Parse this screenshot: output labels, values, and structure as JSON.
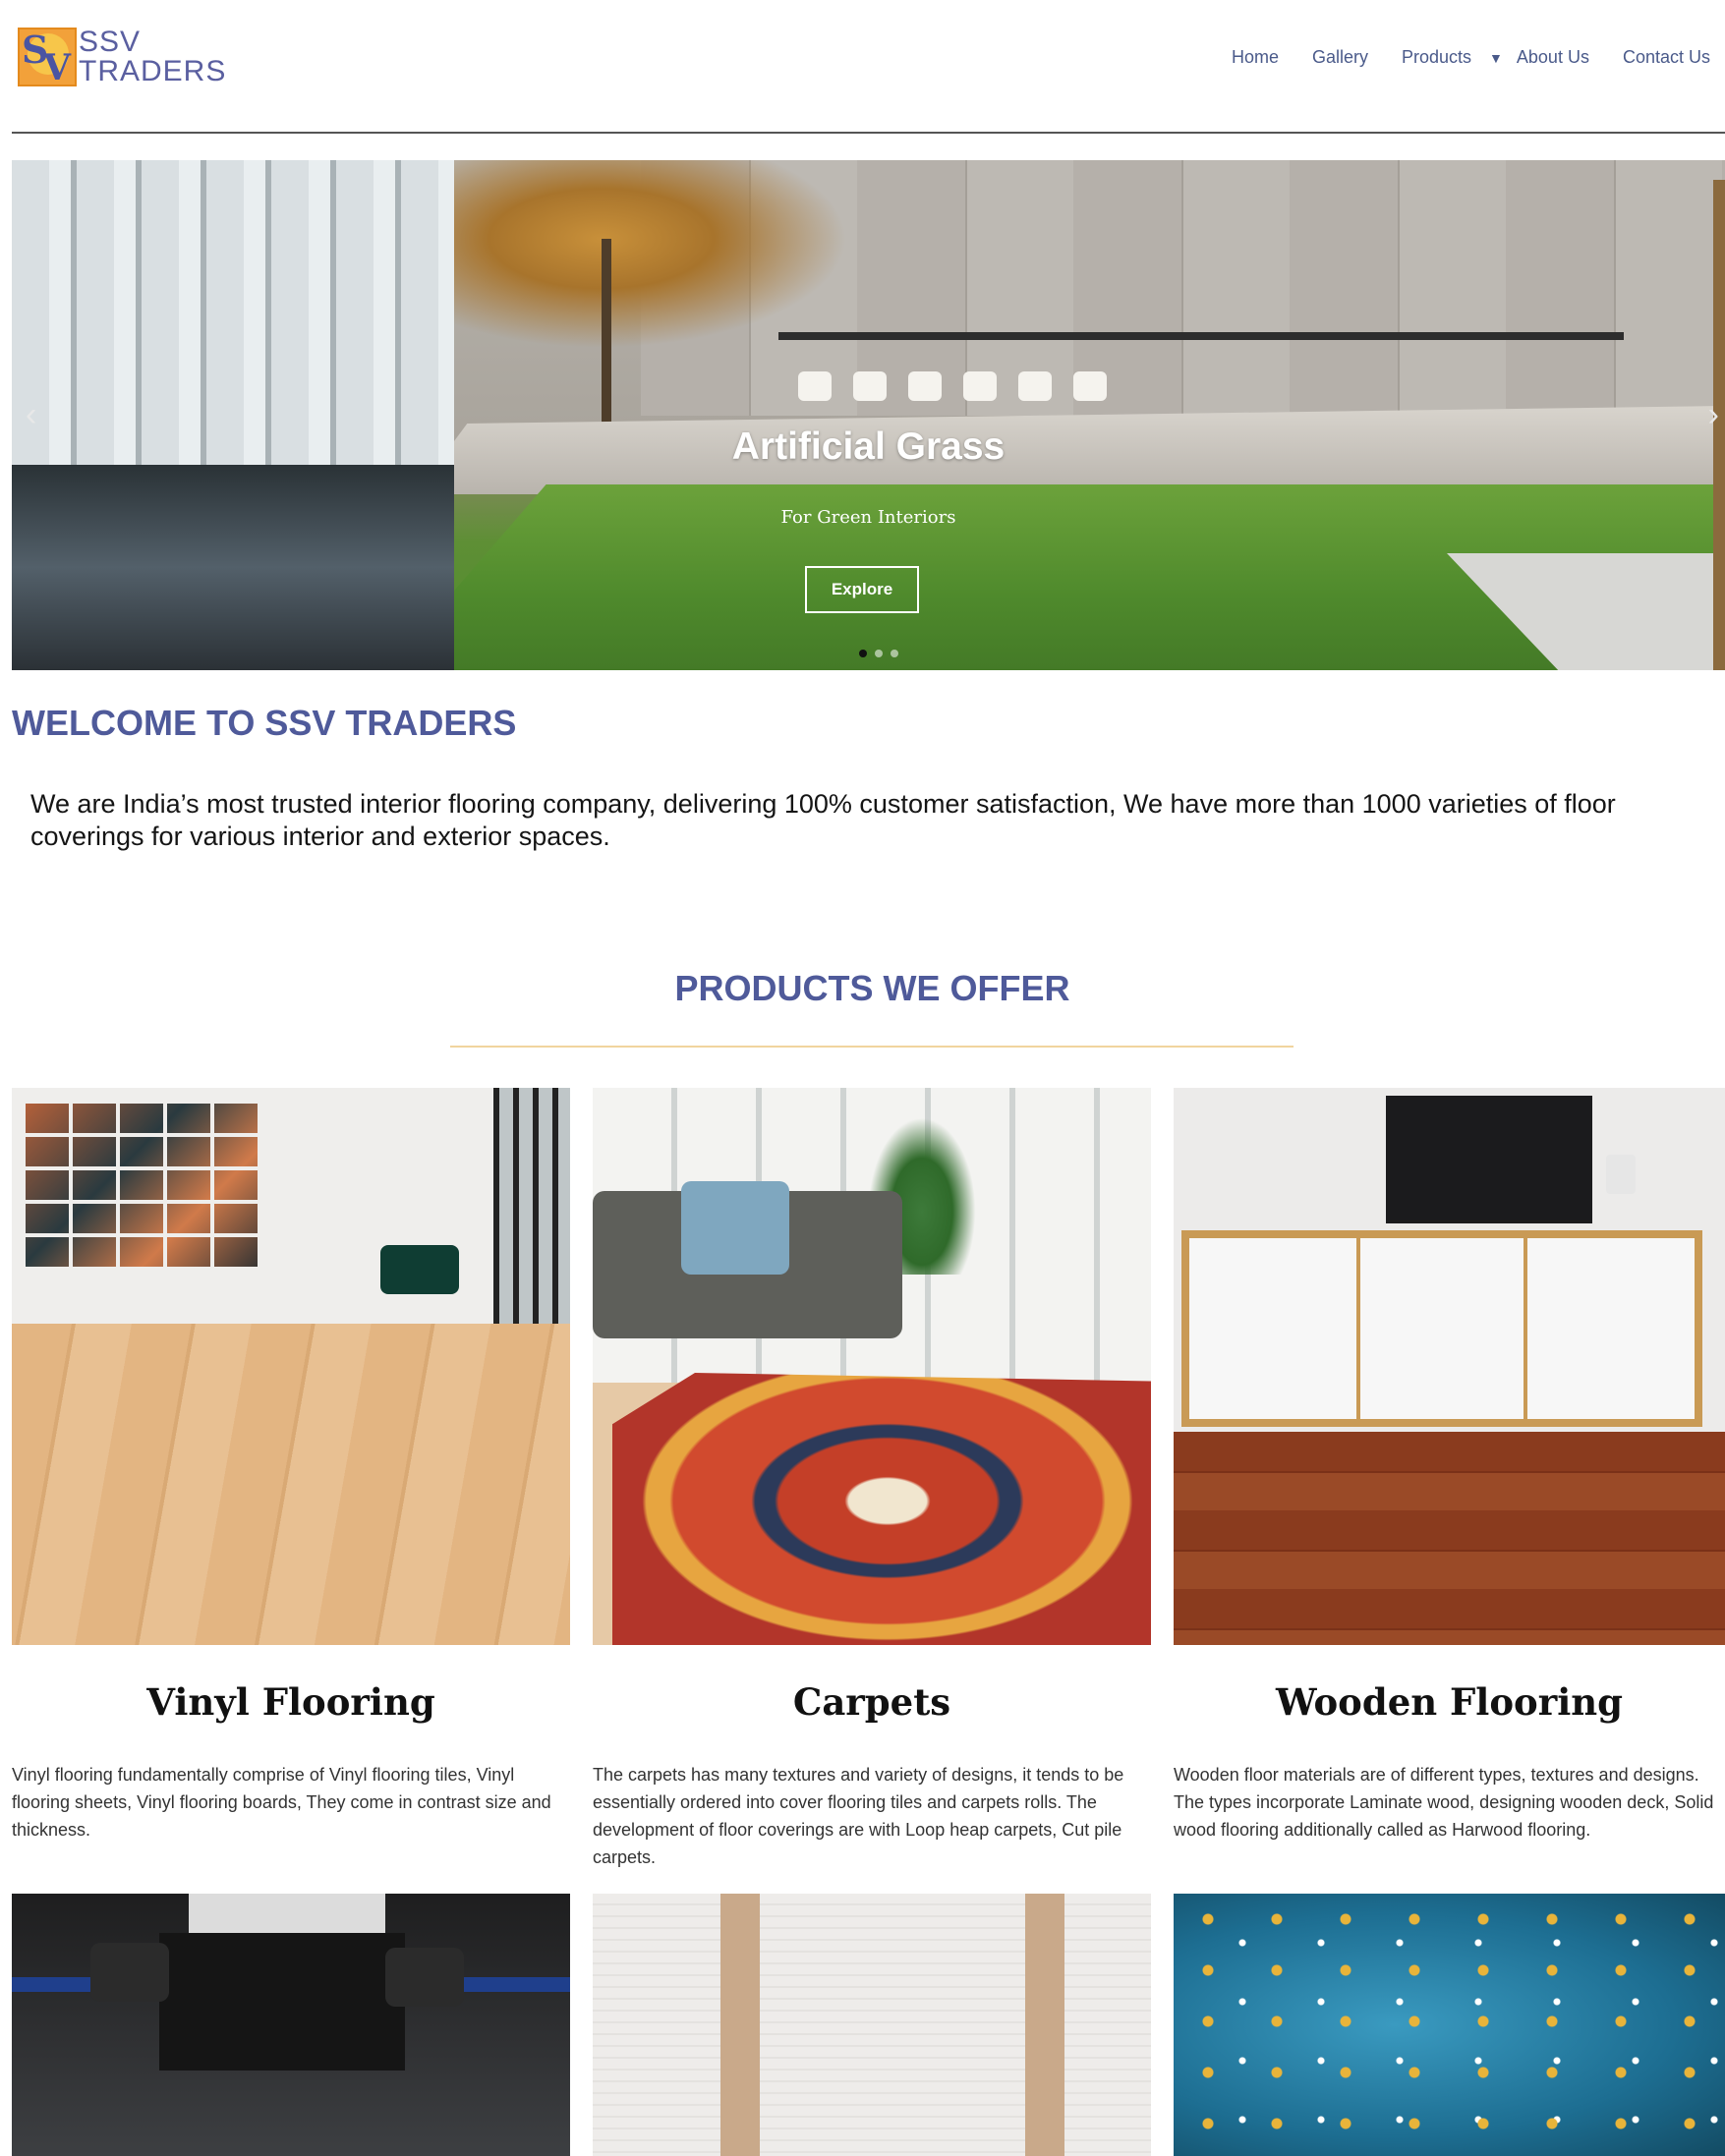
{
  "header": {
    "logo_line1": "SSV",
    "logo_line2": "TRADERS",
    "nav": {
      "home": "Home",
      "gallery": "Gallery",
      "products": "Products",
      "products_caret": "▼",
      "about": "About Us",
      "contact": "Contact Us"
    }
  },
  "hero": {
    "title": "Artificial Grass",
    "subtitle": "For Green Interiors",
    "button": "Explore",
    "prev_arrow": "‹",
    "next_arrow": "›",
    "slide_count": 3,
    "active_slide": 1
  },
  "welcome": {
    "title": "WELCOME TO SSV TRADERS",
    "text": "We are India’s most trusted interior flooring company, delivering 100% customer satisfaction, We have more than 1000 varieties of floor coverings for various interior and exterior spaces."
  },
  "products": {
    "title": "PRODUCTS WE OFFER",
    "items": [
      {
        "name": "Vinyl Flooring",
        "desc": "Vinyl flooring fundamentally comprise of Vinyl flooring tiles, Vinyl flooring sheets, Vinyl flooring boards, They come in contrast size and thickness."
      },
      {
        "name": "Carpets",
        "desc": "The carpets has many textures and variety of designs, it tends to be essentially ordered into cover flooring tiles and carpets rolls. The development of floor coverings are with Loop heap carpets, Cut pile carpets."
      },
      {
        "name": "Wooden Flooring",
        "desc": "Wooden floor materials are of different types, textures and designs. The types incorporate Laminate wood, designing wooden deck, Solid wood flooring additionally called as Harwood flooring."
      }
    ]
  },
  "colors": {
    "brand_blue": "#4f5a9a",
    "nav_text": "#4a5a8a",
    "divider_gold": "#f1d49e",
    "logo_orange": "#f2a13a"
  }
}
